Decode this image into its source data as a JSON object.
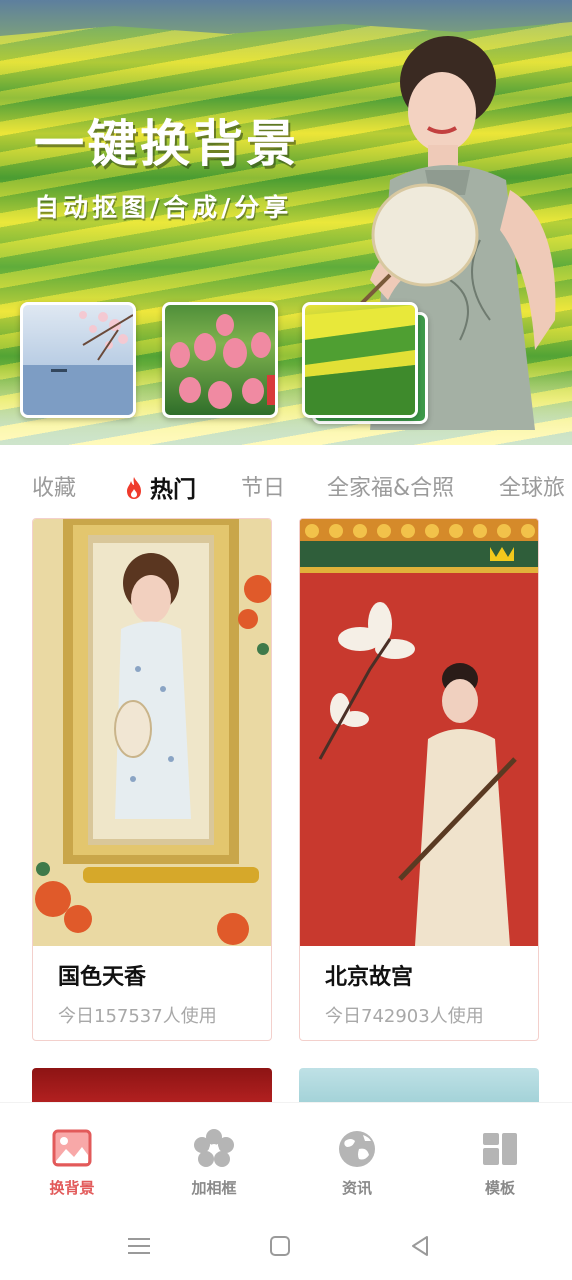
{
  "hero": {
    "title": "一键换背景",
    "subtitle": "自动抠图/合成/分享",
    "background_thumbs": [
      {
        "name": "lake-blossom",
        "selected": false
      },
      {
        "name": "tulips",
        "selected": false
      },
      {
        "name": "rapeseed-field",
        "selected": true
      }
    ]
  },
  "tabs": [
    {
      "label": "收藏",
      "active": false
    },
    {
      "label": "热门",
      "active": true,
      "icon": "fire-icon"
    },
    {
      "label": "节日",
      "active": false
    },
    {
      "label": "全家福&合照",
      "active": false
    },
    {
      "label": "全球旅",
      "active": false
    }
  ],
  "cards": [
    {
      "title": "国色天香",
      "usage": "今日157537人使用"
    },
    {
      "title": "北京故宫",
      "usage": "今日742903人使用"
    }
  ],
  "bottom_nav": [
    {
      "label": "换背景",
      "icon": "image-icon",
      "active": true
    },
    {
      "label": "加相框",
      "icon": "flower-frame-icon",
      "active": false
    },
    {
      "label": "资讯",
      "icon": "globe-icon",
      "active": false
    },
    {
      "label": "模板",
      "icon": "template-grid-icon",
      "active": false
    }
  ],
  "colors": {
    "accent": "#e25a5a",
    "inactive_text": "#9b9b9b",
    "card_border": "#f3d0cc"
  }
}
